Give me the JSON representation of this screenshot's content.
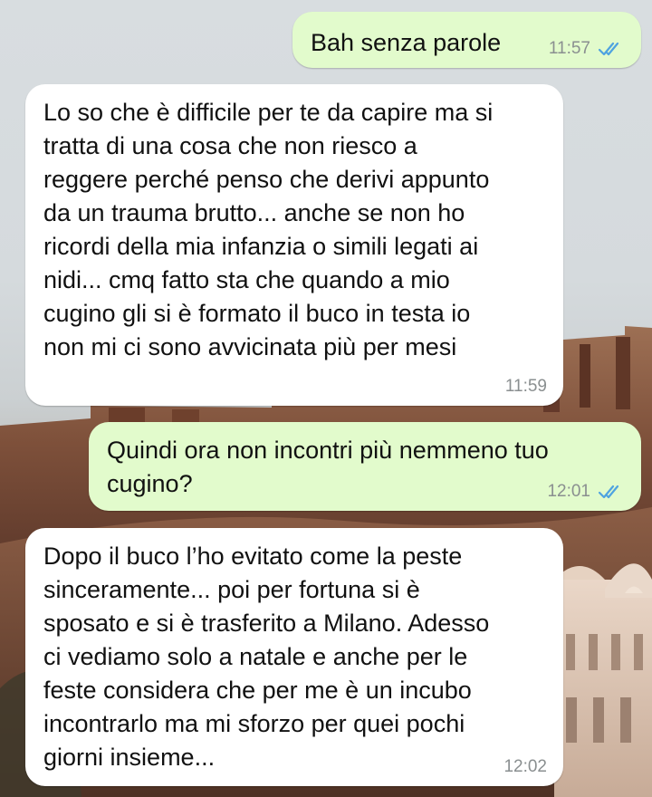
{
  "messages": [
    {
      "direction": "outgoing",
      "text": "Bah senza parole",
      "time": "11:57",
      "status": "read-double-check"
    },
    {
      "direction": "incoming",
      "text": "Lo so che è difficile per te da capire ma si\ntratta di una cosa che non riesco a\nreggere perché penso che derivi appunto\nda un trauma brutto... anche se non ho\nricordi della mia infanzia o simili legati ai\nnidi... cmq fatto sta che quando a mio\ncugino gli si è formato il buco in testa io\nnon mi ci sono avvicinata più per mesi",
      "time": "11:59"
    },
    {
      "direction": "outgoing",
      "text": "Quindi ora non incontri più nemmeno tuo\ncugino?",
      "time": "12:01",
      "status": "read-double-check"
    },
    {
      "direction": "incoming",
      "text": "Dopo il buco l’ho evitato come la peste\nsinceramente... poi per fortuna si è\nsposato e si è trasferito a Milano. Adesso\nci vediamo solo a natale e anche per le\nfeste considera che per me è un incubo\nincontrarlo ma mi sforzo per quei pochi\ngiorni insieme...",
      "time": "12:02"
    }
  ],
  "colors": {
    "outgoing_bubble": "#e2fbcc",
    "incoming_bubble": "#ffffff",
    "read_ticks": "#4fa3e0",
    "timestamp": "#8a8f90"
  }
}
